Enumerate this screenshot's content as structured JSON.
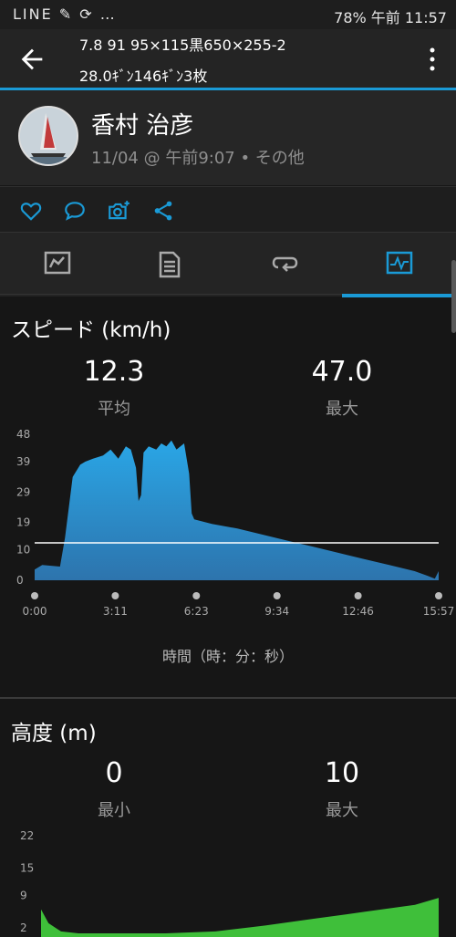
{
  "status_bar": {
    "left_icons": "LINE ✎ ⟳ …",
    "right_text": "78% 午前 11:57"
  },
  "app_bar": {
    "title_line1": "7.8 91 95×115黒650×255-2",
    "title_line2": "28.0ｷﾞﾝ146ｷﾞﾝ3枚"
  },
  "activity": {
    "user_name": "香村 治彦",
    "meta": "11/04 @ 午前9:07 • その他"
  },
  "speed": {
    "title": "スピード (km/h)",
    "avg_value": "12.3",
    "avg_label": "平均",
    "max_value": "47.0",
    "max_label": "最大",
    "x_axis_label": "時間（時：分：秒）"
  },
  "elevation": {
    "title": "高度 (m)",
    "min_value": "0",
    "min_label": "最小",
    "max_value": "10",
    "max_label": "最大"
  },
  "colors": {
    "accent": "#1a9ad6",
    "speed_fill": "#2f9fd8",
    "elev_fill": "#3fbf3a",
    "avg_line": "#ffffff"
  },
  "chart_data": [
    {
      "type": "area",
      "title": "スピード (km/h)",
      "y_ticks": [
        "48",
        "39",
        "29",
        "19",
        "10",
        "0"
      ],
      "x_ticks": [
        "0:00",
        "3:11",
        "6:23",
        "9:34",
        "12:46",
        "15:57"
      ],
      "ylim": [
        0,
        48
      ],
      "xlim_minutes": [
        0,
        15.95
      ],
      "average": 12.3,
      "x_minutes": [
        0,
        0.3,
        1.0,
        1.2,
        1.5,
        1.8,
        2.0,
        2.3,
        2.7,
        3.0,
        3.3,
        3.6,
        3.8,
        4.0,
        4.1,
        4.2,
        4.3,
        4.5,
        4.8,
        5.0,
        5.2,
        5.4,
        5.6,
        5.9,
        6.1,
        6.2,
        6.3,
        7.0,
        8.0,
        9.0,
        10.0,
        11.0,
        12.0,
        13.0,
        14.0,
        15.0,
        15.5,
        15.8,
        15.95
      ],
      "values": [
        3.5,
        5,
        4.5,
        14,
        34,
        38,
        39,
        40,
        41,
        43,
        40,
        44,
        43,
        37,
        26,
        28,
        42,
        44,
        43,
        45,
        44,
        46,
        43,
        45,
        35,
        22,
        20,
        18.5,
        17,
        15,
        13,
        11,
        9,
        7,
        5,
        3,
        1.5,
        0.5,
        3
      ]
    },
    {
      "type": "area",
      "title": "高度 (m)",
      "y_ticks": [
        "22",
        "15",
        "9",
        "2"
      ],
      "ylim": [
        0,
        22
      ],
      "x_minutes": [
        0,
        0.3,
        0.8,
        1.5,
        3.0,
        5.0,
        7.0,
        9.0,
        11.0,
        13.0,
        15.0,
        15.95
      ],
      "values": [
        6,
        3,
        1.2,
        0.8,
        0.8,
        0.8,
        1.2,
        2.5,
        4.0,
        5.5,
        7.0,
        8.5
      ]
    }
  ]
}
